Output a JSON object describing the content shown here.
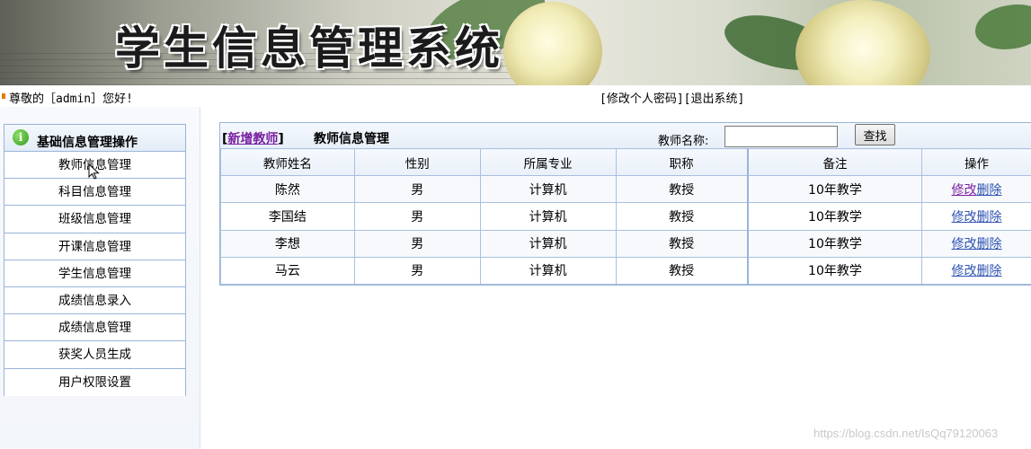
{
  "banner": {
    "title": "学生信息管理系统"
  },
  "topbar": {
    "greeting": "尊敬的［admin］您好!",
    "change_password": "[修改个人密码]",
    "logout": "[退出系统]"
  },
  "sidebar": {
    "header": "基础信息管理操作",
    "items": [
      {
        "label": "教师信息管理"
      },
      {
        "label": "科目信息管理"
      },
      {
        "label": "班级信息管理"
      },
      {
        "label": "开课信息管理"
      },
      {
        "label": "学生信息管理"
      },
      {
        "label": "成绩信息录入"
      },
      {
        "label": "成绩信息管理"
      },
      {
        "label": "获奖人员生成"
      },
      {
        "label": "用户权限设置"
      }
    ]
  },
  "main": {
    "add_bracket_left": "[",
    "add_teacher": "新增教师",
    "add_bracket_right": "]",
    "title": "教师信息管理",
    "search_label": "教师名称:",
    "search_value": "",
    "search_button": "查找",
    "columns": [
      "教师姓名",
      "性别",
      "所属专业",
      "职称",
      "备注",
      "操作"
    ],
    "rows": [
      {
        "name": "陈然",
        "gender": "男",
        "major": "计算机",
        "title": "教授",
        "note": "10年教学",
        "edit": "修改",
        "delete": "删除"
      },
      {
        "name": "李国结",
        "gender": "男",
        "major": "计算机",
        "title": "教授",
        "note": "10年教学",
        "edit": "修改",
        "delete": "删除"
      },
      {
        "name": "李想",
        "gender": "男",
        "major": "计算机",
        "title": "教授",
        "note": "10年教学",
        "edit": "修改",
        "delete": "删除"
      },
      {
        "name": "马云",
        "gender": "男",
        "major": "计算机",
        "title": "教授",
        "note": "10年教学",
        "edit": "修改",
        "delete": "删除"
      }
    ]
  },
  "watermark": "https://blog.csdn.net/IsQq79120063",
  "colors": {
    "link_visited": "#7a1fa0",
    "link": "#2d52b0",
    "border": "#9ab4d8",
    "bullet": "#e07a00"
  }
}
